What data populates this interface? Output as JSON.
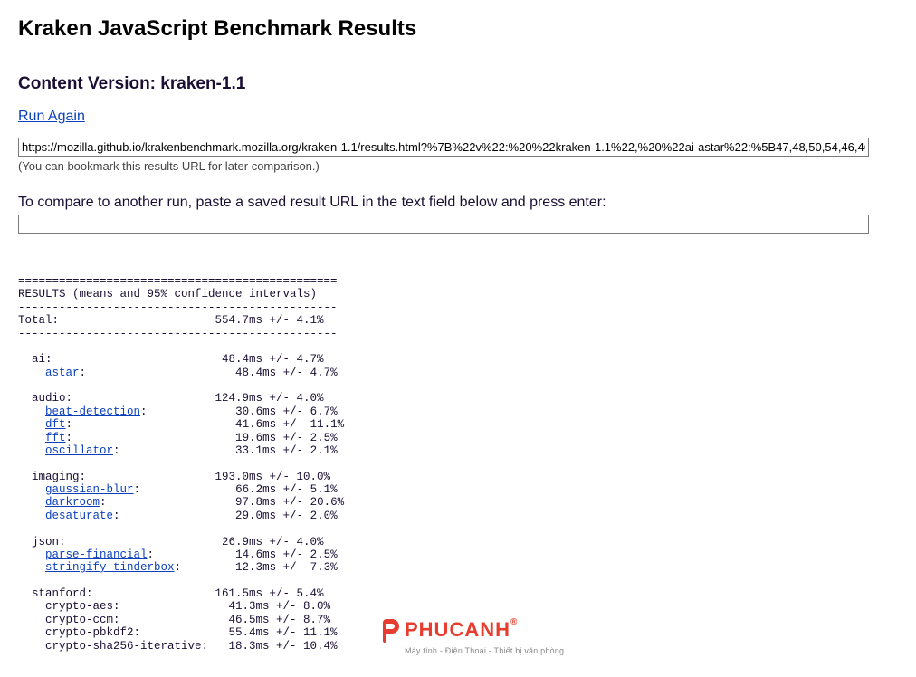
{
  "title": "Kraken JavaScript Benchmark Results",
  "subtitle": "Content Version: kraken-1.1",
  "run_again": "Run Again",
  "result_url": "https://mozilla.github.io/krakenbenchmark.mozilla.org/kraken-1.1/results.html?%7B%22v%22:%20%22kraken-1.1%22,%20%22ai-astar%22:%5B47,48,50,54,46,46",
  "bookmark_hint": "(You can bookmark this results URL for later comparison.)",
  "compare_label": "To compare to another run, paste a saved result URL in the text field below and press enter:",
  "compare_value": "",
  "pre": {
    "hdr_eq": "===============================================",
    "hdr": "RESULTS (means and 95% confidence intervals)",
    "hdr_dash": "-----------------------------------------------",
    "total": "Total:                       554.7ms +/- 4.1%",
    "sep": "-----------------------------------------------",
    "blank": "",
    "ai_hdr": "  ai:                         48.4ms +/- 4.7%",
    "ai_astar_a": "astar",
    "ai_astar": ":                      48.4ms +/- 4.7%",
    "audio_hdr": "  audio:                     124.9ms +/- 4.0%",
    "audio_bd_a": "beat-detection",
    "audio_bd": ":             30.6ms +/- 6.7%",
    "audio_dft_a": "dft",
    "audio_dft": ":                        41.6ms +/- 11.1%",
    "audio_fft_a": "fft",
    "audio_fft": ":                        19.6ms +/- 2.5%",
    "audio_osc_a": "oscillator",
    "audio_osc": ":                 33.1ms +/- 2.1%",
    "img_hdr": "  imaging:                   193.0ms +/- 10.0%",
    "img_gb_a": "gaussian-blur",
    "img_gb": ":              66.2ms +/- 5.1%",
    "img_dr_a": "darkroom",
    "img_dr": ":                   97.8ms +/- 20.6%",
    "img_ds_a": "desaturate",
    "img_ds": ":                 29.0ms +/- 2.0%",
    "json_hdr": "  json:                       26.9ms +/- 4.0%",
    "json_pf_a": "parse-financial",
    "json_pf": ":            14.6ms +/- 2.5%",
    "json_st_a": "stringify-tinderbox",
    "json_st": ":        12.3ms +/- 7.3%",
    "stan_hdr": "  stanford:                  161.5ms +/- 5.4%",
    "stan_aes": "    crypto-aes:                41.3ms +/- 8.0%",
    "stan_ccm": "    crypto-ccm:                46.5ms +/- 8.7%",
    "stan_pbk": "    crypto-pbkdf2:             55.4ms +/- 11.1%",
    "stan_sha": "    crypto-sha256-iterative:   18.3ms +/- 10.4%"
  },
  "watermark": {
    "brand": "PHUCANH",
    "reg": "®",
    "tagline": "Máy tính - Điện Thoại - Thiết bị văn phòng"
  }
}
